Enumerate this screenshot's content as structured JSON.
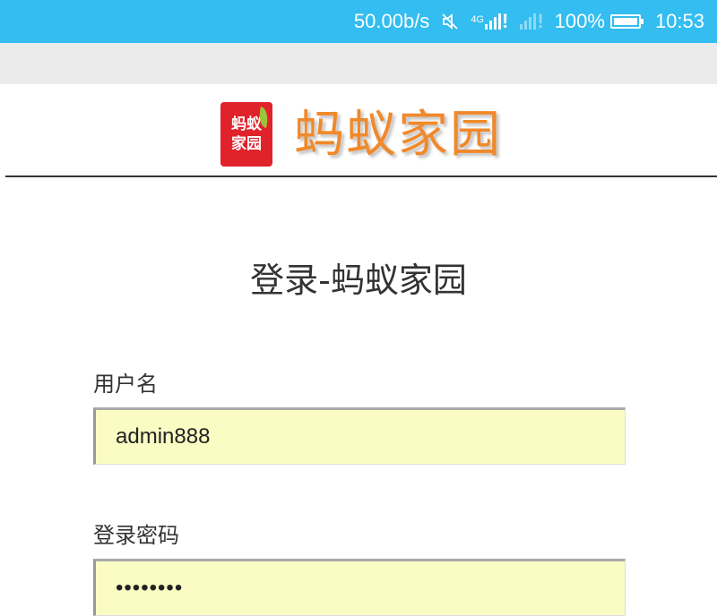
{
  "status_bar": {
    "net_speed": "50.00b/s",
    "mute_icon": "mute-icon",
    "network_type": "4G",
    "battery_percent": "100%",
    "time": "10:53"
  },
  "brand": {
    "badge_line1": "蚂蚁",
    "badge_line2": "家园",
    "logo_text": "蚂蚁家园"
  },
  "page": {
    "title": "登录-蚂蚁家园"
  },
  "form": {
    "username_label": "用户名",
    "username_value": "admin888",
    "password_label": "登录密码",
    "password_value": "••••••••"
  },
  "colors": {
    "status_bar": "#33bdf0",
    "input_bg": "#fafcc4",
    "logo_orange": "#f0892b",
    "badge_red": "#e0222a"
  }
}
